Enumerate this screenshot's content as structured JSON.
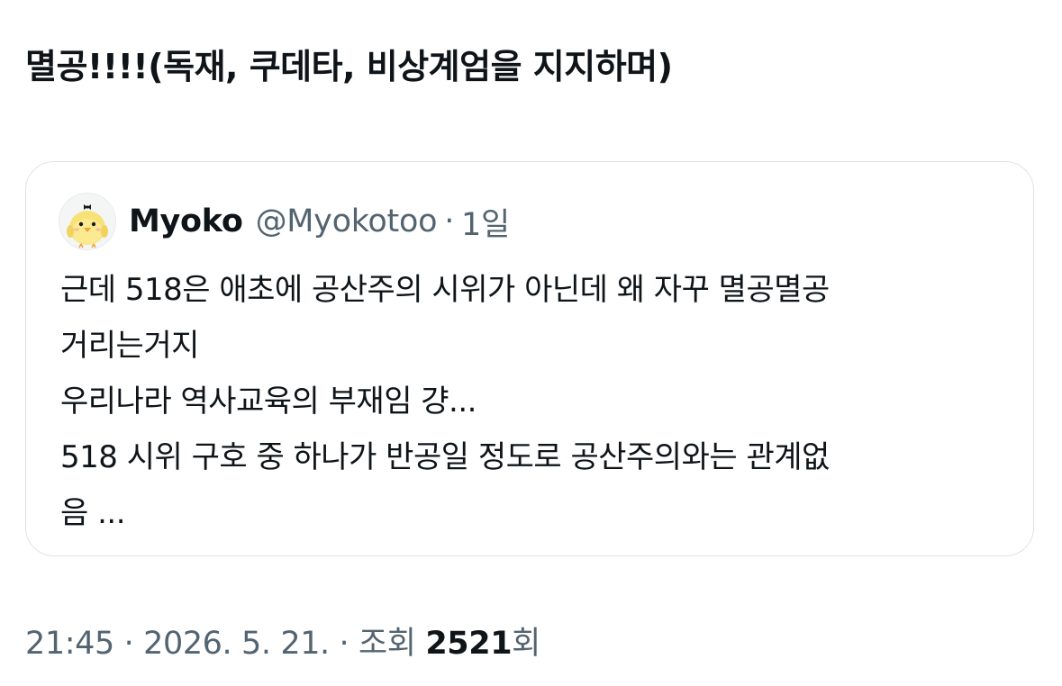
{
  "tweet": {
    "text": "멸공!!!!(독재, 쿠데타, 비상계엄을 지지하며)"
  },
  "quote": {
    "author_name": "Myoko",
    "author_handle": "@Myokotoo",
    "separator": "·",
    "time_ago": "1일",
    "avatar_icon": "chick-avatar-icon",
    "body_lines": [
      "근데 518은 애초에 공산주의 시위가 아닌데 왜 자꾸 멸공멸공",
      "거리는거지",
      "우리나라 역사교육의 부재임 걍...",
      "518 시위 구호 중 하나가 반공일 정도로 공산주의와는 관계없",
      "음 ..."
    ]
  },
  "meta": {
    "time": "21:45",
    "separator": "·",
    "date": "2026. 5. 21.",
    "views_label": "조회",
    "views_count": "2521",
    "views_suffix": "회"
  },
  "colors": {
    "text_primary": "#0f1419",
    "text_secondary": "#536471",
    "border": "#dfe3e7"
  }
}
